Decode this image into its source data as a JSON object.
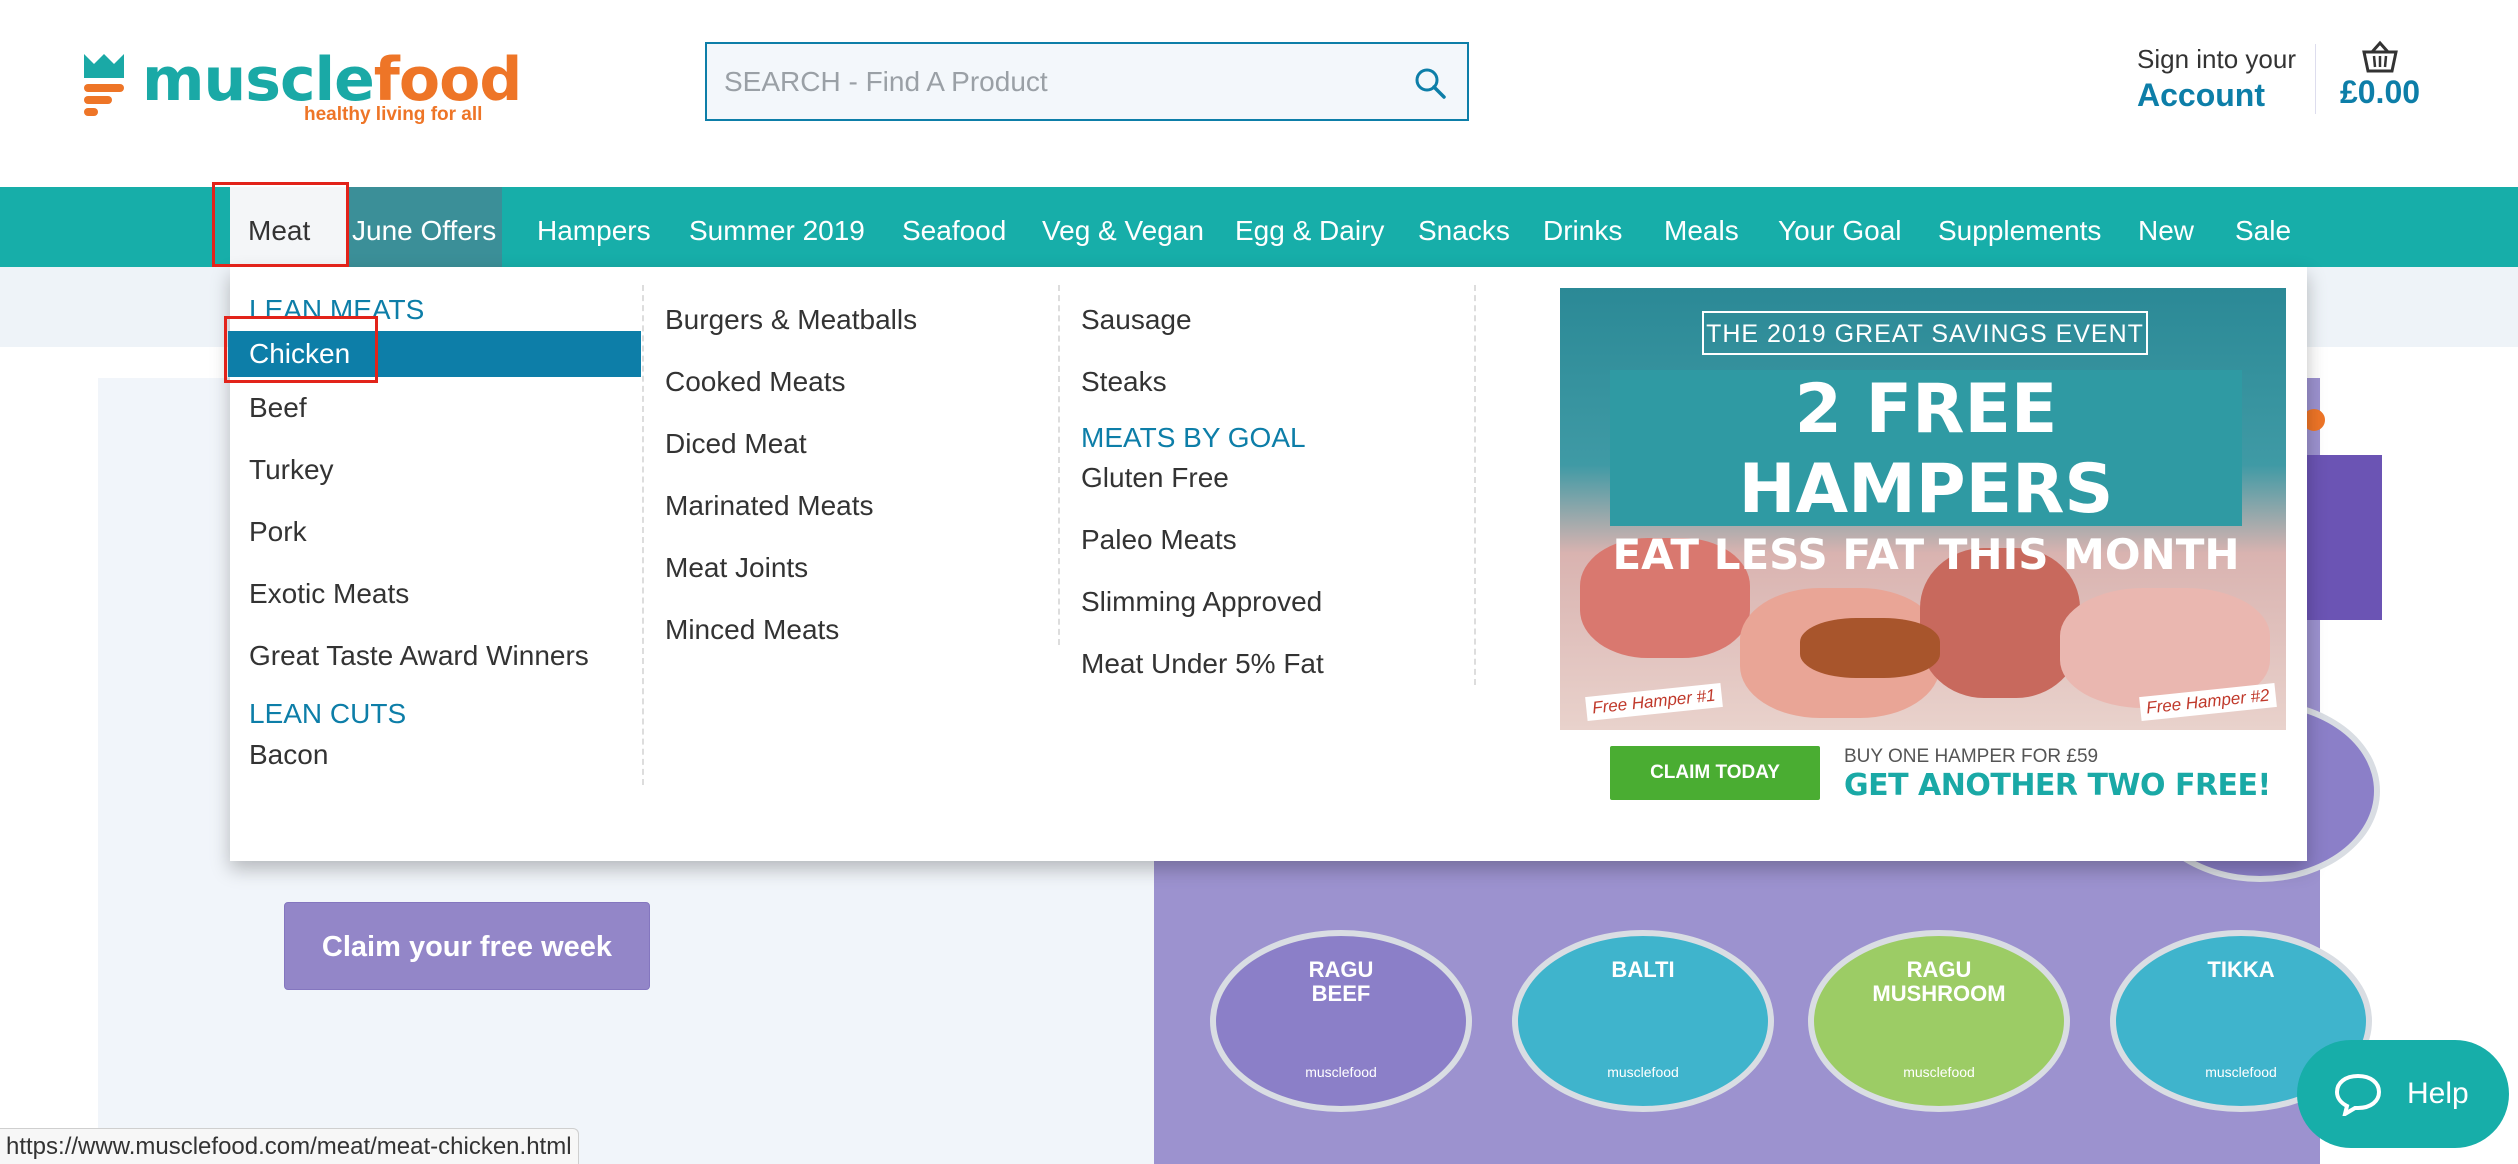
{
  "brand": {
    "word1": "muscle",
    "word2": "food",
    "tagline": "healthy living for all",
    "colors": {
      "teal": "#17aea9",
      "orange": "#ee7527",
      "blue": "#0d7ea8"
    }
  },
  "search": {
    "placeholder": "SEARCH - Find A Product",
    "icon": "search-icon"
  },
  "account": {
    "line1": "Sign into your",
    "line2": "Account"
  },
  "basket": {
    "icon": "basket-icon",
    "total": "£0.00"
  },
  "nav": {
    "items": [
      "Meat",
      "June Offers",
      "Hampers",
      "Summer 2019",
      "Seafood",
      "Veg & Vegan",
      "Egg & Dairy",
      "Snacks",
      "Drinks",
      "Meals",
      "Your Goal",
      "Supplements",
      "New",
      "Sale"
    ],
    "active": "Meat"
  },
  "mega": {
    "col1": {
      "heading1": "LEAN MEATS",
      "items1": [
        "Chicken",
        "Beef",
        "Turkey",
        "Pork",
        "Exotic Meats",
        "Great Taste Award Winners"
      ],
      "heading2": "LEAN CUTS",
      "items2": [
        "Bacon"
      ]
    },
    "col2": {
      "items": [
        "Burgers & Meatballs",
        "Cooked Meats",
        "Diced Meat",
        "Marinated Meats",
        "Meat Joints",
        "Minced Meats"
      ]
    },
    "col3": {
      "items1": [
        "Sausage",
        "Steaks"
      ],
      "heading": "MEATS BY GOAL",
      "items2": [
        "Gluten Free",
        "Paleo Meats",
        "Slimming Approved",
        "Meat Under 5% Fat"
      ]
    },
    "promo": {
      "event": "THE 2019 GREAT SAVINGS EVENT",
      "headline1": "2 FREE HAMPERS",
      "headline2": "EAT LESS FAT THIS MONTH",
      "tag1": "Free Hamper #1",
      "tag2": "Free Hamper #2",
      "cta": "CLAIM TODAY",
      "buy_line": "BUY ONE HAMPER FOR £59",
      "free_line": "GET ANOTHER TWO FREE!"
    }
  },
  "hero": {
    "cta": "Claim your free week",
    "tubs": [
      {
        "name": "RAGU",
        "sub": "BEEF",
        "brand": "musclefood",
        "color": "#8b7fc8"
      },
      {
        "name": "BALTI",
        "sub": "",
        "brand": "musclefood",
        "color": "#3fb4cc"
      },
      {
        "name": "RAGU",
        "sub": "MUSHROOM",
        "brand": "musclefood",
        "color": "#9ccc65"
      },
      {
        "name": "TIKKA",
        "sub": "",
        "brand": "musclefood",
        "color": "#3fb4cc"
      }
    ]
  },
  "status_url": "https://www.musclefood.com/meat/meat-chicken.html",
  "help": {
    "label": "Help",
    "icon": "chat-bubble-icon"
  }
}
